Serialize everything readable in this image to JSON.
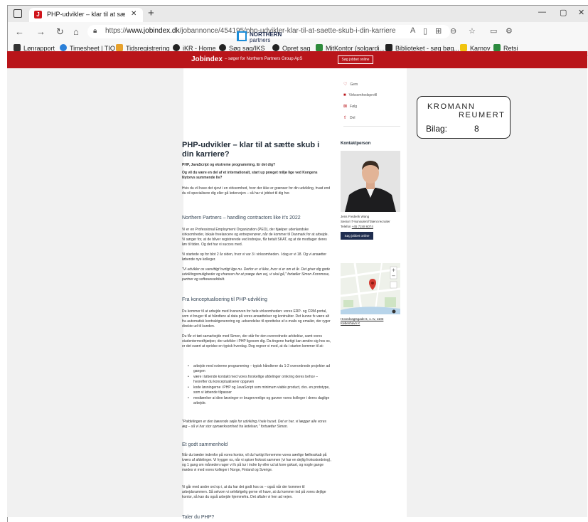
{
  "browser": {
    "tab_title": "PHP-udvikler – klar til at sætte sk",
    "url_prefix": "https://",
    "url_host": "www.jobindex.dk",
    "url_path": "/jobannonce/454195/php-udvikler-klar-til-at-saette-skub-i-din-karriere",
    "bookmarks": [
      "Lønrapport",
      "Timesheet | TIQ",
      "Tidsregistrering",
      "iKR - Home",
      "Søg sag/IKS",
      "Opret sag",
      "MitKontor (solgardi...",
      "Biblioteket - søg bøg...",
      "Karnov",
      "Retsi"
    ],
    "bookmark_colors": [
      "#333333",
      "#2a7fd8",
      "#e7a12b",
      "#222222",
      "#222222",
      "#222222",
      "#2f8b3c",
      "#222222",
      "#f1c40f",
      "#2b8a3e"
    ]
  },
  "jobindex": {
    "logo": "Jobindex",
    "subtitle": "– søger for Northern Partners Group ApS",
    "button": "Søg jobbet online"
  },
  "company": {
    "name_line1": "NORTHERN",
    "name_line2": "partners"
  },
  "side_actions": [
    {
      "icon": "heart-icon",
      "glyph": "♡",
      "label": "Gem"
    },
    {
      "icon": "building-icon",
      "glyph": "■",
      "label": "Virksomhedsprofil"
    },
    {
      "icon": "follow-icon",
      "glyph": "⊠",
      "label": "Følg"
    },
    {
      "icon": "share-icon",
      "glyph": "⇧",
      "label": "Del"
    }
  ],
  "job": {
    "title": "PHP-udvikler – klar til at sætte skub i din karriere?",
    "lead1": "PHP, JavaScript og ekstreme programming. Er det dig?",
    "lead2": "Og vil du være en del af et internationalt, start up præget miljø lige ved Kongens Nytorvs summende liv?",
    "intro": "Hvis du vil have det sjovt i en virksomhed, hvor der ikke er grænser for din udvikling, hvad end du vil specialisere dig eller gå ledervejen – så har vi jobbet til dig her.",
    "h_about": "Northern Partners – handling contractors like it's 2022",
    "about1": "Vi er en Professional Employment Organization (PEO), der hjælper udenlandske virksomheder, lokale freelancere og entreprenører, når de kommer til Danmark for at arbejde. Vi sørger for, at de bliver registrerede ved indrejse, får betalt SKAT, og at de modtager deres løn til tiden. Og det har vi succes med.",
    "about2": "Vi startede op for blot 2 år siden, hvor vi var 3 i virksomheden. I dag er vi 18. Og vi ansætter løbende nye kolleger.",
    "quote1": "\"Vi udvikler os vanvittigt hurtigt lige nu. Derfor er vi ikke, hvor vi er om et år. Det giver dig gode udviklingsmuligheder og chancen for at præge den vej, vi skal gå,\" fortæller Simon Kronmose, partner og softwarearkitekt.",
    "h_concept": "Fra konceptualisering til PHP-udvikling",
    "concept1": "Du kommer til at arbejde med livsnerven for hele virksomheden: vores ERP- og CRM-portal, som vi bruger til at håndtere al data på vores ansættelser og kontrakter. Det kunne fx være alt fra automatisk kontraktgenerering og -udsendelse til oprettelse af e-mails og emailer, der ryger direkte ud til kunden.",
    "concept2": "Du får et tæt samarbejde med Simon, der står for den overordnede arkitektur, samt vores studentermedhjælper, der udvikler i PHP ligesom dig. Da tingene hurtigt kan ændre sig hos os, er det svært at opridse en typisk hverdag. Dog regner vi med, at du i starten kommer til at:",
    "bullets": [
      "arbejde med extreme programming – typisk håndterer du 1-2 overordnede projekter ad gangen",
      "være i løbende kontakt med vores forskellige afdelinger omkring deres behov – hvorefter du konceptualiserer opgaven",
      "kode løsningerne i PHP og JavaScript som minimum viable product, dvs. en prototype, som vi løbende tilpasser",
      "medtænker at dine løsninger er brugervenlige og gavner vores kolleger i deres daglige arbejde."
    ],
    "quote2": "\"Pafdelingen er den bærende søjle for udvikling i hele huset. Det er her, vi lægger alle vores æg – så vi har stor opmærksomhed fra ledelsen,\" fortsætter Simon.",
    "h_together": "Et godt sammenhold",
    "together1": "Når du træder indenfor på vores kontor, vil du hurtigt fornemme vores særlige fællesskab på tværs af afdelinger. Vi hygger os, når vi spiser frokost sammen (vi har en dejlig frokostordning), og 1 gang om måneden rager vi fx på tur i indre by eller ud at kore gokart, og nogle gange mødes vi med vores kolleger i Norge, Finland og Sverige.",
    "together2": "Vi går med andre ord op i, at du har det godt hos os – også når der kommer til arbejdsrammen. Så selvom vi selvfølgelig gerne vil have, at du kommer ind på vores dejlige kontor, så kan du også arbejde hjemmefra. Det aftaler vi hen ad vejen.",
    "h_php": "Taler du PHP?"
  },
  "contact": {
    "heading": "Kontaktperson",
    "name": "Jens Frederik Wang",
    "role": "Senior IT-konsulent/Talent recruiter",
    "phone_label": "Telefon",
    "phone": "+45 7248 6074",
    "button": "Søg jobbet online",
    "address": "Hovedvagtsgade 6, 1. tv, 1103 København K"
  },
  "stamp": {
    "line1": "KROMANN",
    "line2": "REUMERT",
    "bilag_label": "Bilag:",
    "bilag_number": "8"
  }
}
